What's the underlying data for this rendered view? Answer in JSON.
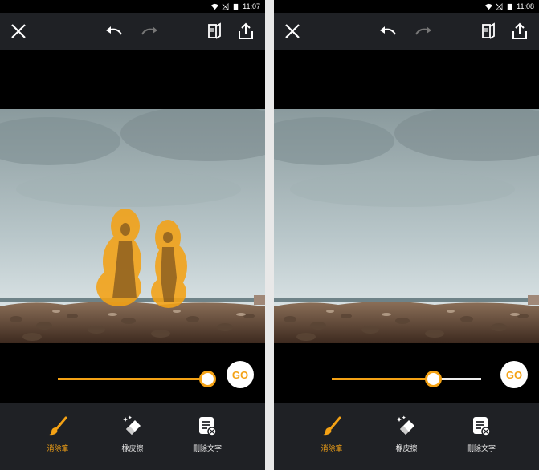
{
  "screens": [
    {
      "status": {
        "time": "11:07"
      },
      "brush_level": 0.9,
      "go_label": "GO",
      "tools": [
        {
          "label": "消除筆",
          "icon": "brush-icon",
          "active": true
        },
        {
          "label": "橡皮擦",
          "icon": "eraser-icon",
          "active": false
        },
        {
          "label": "刪除文字",
          "icon": "text-remove-icon",
          "active": false
        }
      ],
      "has_mask": true
    },
    {
      "status": {
        "time": "11:08"
      },
      "brush_level": 0.68,
      "go_label": "GO",
      "tools": [
        {
          "label": "消除筆",
          "icon": "brush-icon",
          "active": true
        },
        {
          "label": "橡皮擦",
          "icon": "eraser-icon",
          "active": false
        },
        {
          "label": "刪除文字",
          "icon": "text-remove-icon",
          "active": false
        }
      ],
      "has_mask": false
    }
  ],
  "colors": {
    "accent": "#f4a215",
    "toolbar": "#1f2125",
    "background": "#000000"
  }
}
